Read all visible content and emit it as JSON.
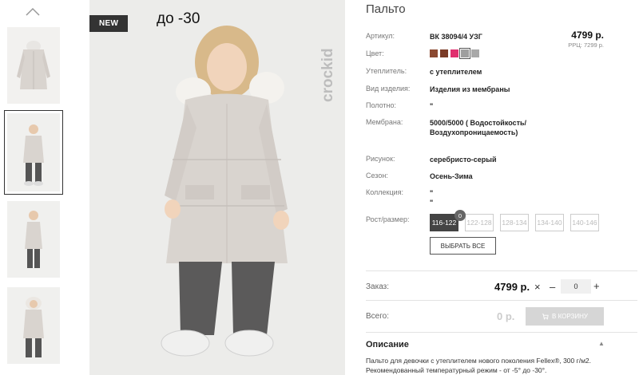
{
  "thumbnails": {
    "up_icon": "chevron-up-icon",
    "count": 4,
    "active_index": 1
  },
  "main_image": {
    "badge": "NEW",
    "temperature": "до -30",
    "brand": "crockid"
  },
  "product": {
    "title": "Пальто",
    "price": "4799 р.",
    "rrp": "РРЦ: 7299 р.",
    "attributes": [
      {
        "key": "Артикул:",
        "value": "ВК 38094/4 УЗГ"
      },
      {
        "key": "Цвет:",
        "value": ""
      },
      {
        "key": "Утеплитель:",
        "value": "с утеплителем"
      },
      {
        "key": "Вид изделия:",
        "value": "Изделия из мембраны"
      },
      {
        "key": "Полотно:",
        "value": "\""
      },
      {
        "key": "Мембрана:",
        "value": "5000/5000 ( Водостойкость/ Воздухопроницаемость)"
      },
      {
        "key": "Рисунок:",
        "value": "серебристо-серый"
      },
      {
        "key": "Сезон:",
        "value": "Осень-Зима"
      },
      {
        "key": "Коллекция:",
        "value": "\" \""
      }
    ],
    "colors": [
      "#8b4a32",
      "#7a3b26",
      "#e0306f",
      "#9e9e9e",
      "#a8a8a8"
    ],
    "selected_color_index": 3
  },
  "sizes": {
    "label": "Рост/размер:",
    "options": [
      "116-122",
      "122-128",
      "128-134",
      "134-140",
      "140-146"
    ],
    "selected_index": 0,
    "selected_count": "0",
    "choose_all": "ВЫБРАТЬ ВСЕ"
  },
  "order": {
    "label": "Заказ:",
    "price": "4799 р.",
    "times": "×",
    "minus": "–",
    "quantity": "0",
    "plus": "+"
  },
  "total": {
    "label": "Всего:",
    "price": "0 р.",
    "cart_button": "В КОРЗИНУ",
    "cart_icon": "cart-icon"
  },
  "description": {
    "title": "Описание",
    "caret": "▲",
    "text": "Пальто для девочки с утеплителем нового поколения Fellex®, 300 г/м2. Рекомендованный температурный режим - от -5° до -30°."
  }
}
